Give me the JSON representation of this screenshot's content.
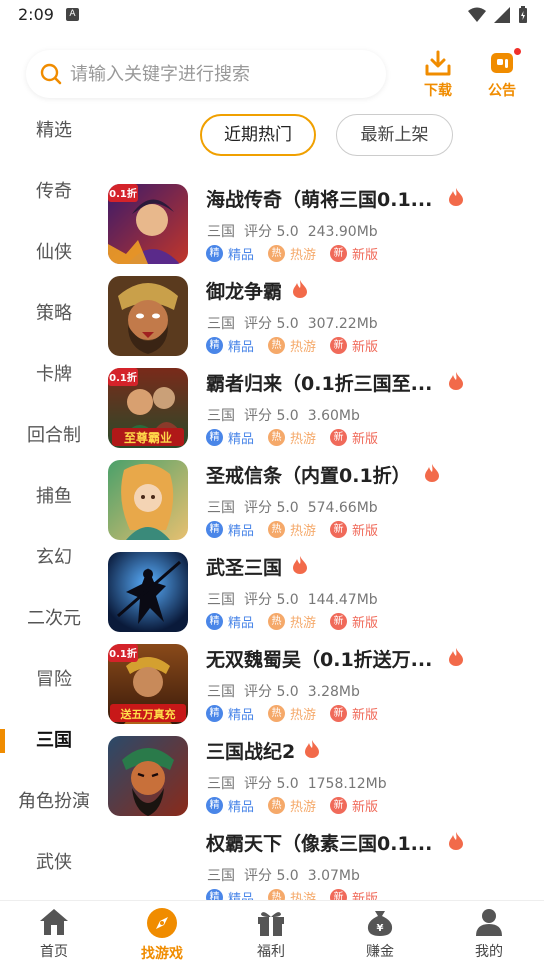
{
  "status_bar": {
    "time": "2:09",
    "notif_letter": "A"
  },
  "search": {
    "placeholder": "请输入关键字进行搜索"
  },
  "top_actions": {
    "download": "下载",
    "notice": "公告"
  },
  "sidebar": {
    "items": [
      "精选",
      "传奇",
      "仙侠",
      "策略",
      "卡牌",
      "回合制",
      "捕鱼",
      "玄幻",
      "二次元",
      "冒险",
      "三国",
      "角色扮演",
      "武侠"
    ],
    "active_index": 10
  },
  "tabs": [
    "近期热门",
    "最新上架"
  ],
  "tag_labels": {
    "jing_badge": "精",
    "jing": "精品",
    "re_badge": "热",
    "re": "热游",
    "xin_badge": "新",
    "xin": "新版"
  },
  "games": [
    {
      "title": "海战传奇（萌将三国0.1...",
      "category": "三国",
      "rating": "评分 5.0",
      "size": "243.90Mb",
      "hot": true
    },
    {
      "title": "御龙争霸",
      "category": "三国",
      "rating": "评分 5.0",
      "size": "307.22Mb",
      "hot": true
    },
    {
      "title": "霸者归来（0.1折三国至...",
      "category": "三国",
      "rating": "评分 5.0",
      "size": "3.60Mb",
      "hot": true
    },
    {
      "title": "圣戒信条（内置0.1折）",
      "category": "三国",
      "rating": "评分 5.0",
      "size": "574.66Mb",
      "hot": true
    },
    {
      "title": "武圣三国",
      "category": "三国",
      "rating": "评分 5.0",
      "size": "144.47Mb",
      "hot": true
    },
    {
      "title": "无双魏蜀吴（0.1折送万...",
      "category": "三国",
      "rating": "评分 5.0",
      "size": "3.28Mb",
      "hot": true
    },
    {
      "title": "三国战纪2",
      "category": "三国",
      "rating": "评分 5.0",
      "size": "1758.12Mb",
      "hot": true
    },
    {
      "title": "权霸天下（像素三国0.1...",
      "category": "三国",
      "rating": "评分 5.0",
      "size": "3.07Mb",
      "hot": true
    }
  ],
  "icon_badges": {
    "game1": "0.1折",
    "game3": "0.1折",
    "game3_banner": "至尊霸业",
    "game6": "0.1折",
    "game6_banner": "送五万真充"
  },
  "bottom_nav": [
    "首页",
    "找游戏",
    "福利",
    "赚金",
    "我的"
  ],
  "bottom_nav_active": 1,
  "earn_coin_glyph": "¥",
  "colors": {
    "accent": "#f08c00",
    "jing": "#4a86e8",
    "re": "#f5a96a",
    "xin": "#f06a5a",
    "flame": "#f26a4a"
  }
}
